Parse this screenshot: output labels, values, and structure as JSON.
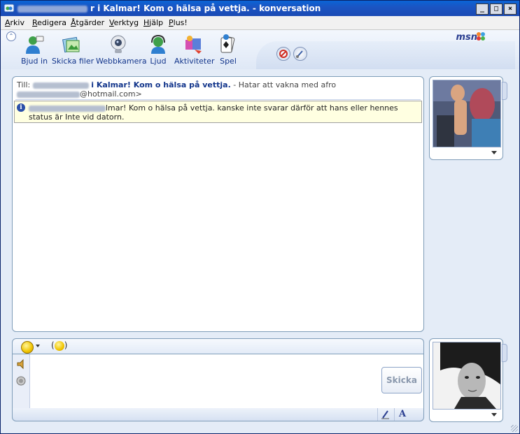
{
  "window": {
    "title": "r i Kalmar! Kom o hälsa på vettja. - konversation",
    "buttons": [
      "_",
      "□",
      "×"
    ]
  },
  "menu": [
    {
      "label": "Arkiv",
      "ul": "A",
      "rest": "rkiv"
    },
    {
      "label": "Redigera",
      "ul": "R",
      "rest": "edigera"
    },
    {
      "label": "Åtgärder",
      "ul": "Å",
      "rest": "tgärder"
    },
    {
      "label": "Verktyg",
      "ul": "V",
      "rest": "erktyg"
    },
    {
      "label": "Hjälp",
      "ul": "H",
      "rest": "jälp"
    },
    {
      "label": "Plus!",
      "ul": "P",
      "rest": "lus!"
    }
  ],
  "toolbar": {
    "invite": "Bjud in",
    "send_files": "Skicka filer",
    "webcam": "Webbkamera",
    "audio": "Ljud",
    "activities": "Aktiviteter",
    "games": "Spel",
    "brand": "msn"
  },
  "conversation": {
    "to_prefix": "Till:",
    "to_name_visible": "i Kalmar! Kom o hälsa på vettja.",
    "to_personal_message": "- Hatar att vakna med afro",
    "to_email_visible": "@hotmail.com>",
    "info_text_visible": "lmar! Kom o hälsa på vettja. kanske inte svarar därför att hans eller hennes status är Inte vid datorn."
  },
  "input": {
    "send_label": "Skicka",
    "font_button": "A"
  },
  "colors": {
    "title_bar": "#1b55c3",
    "link_blue": "#12358b",
    "info_bg": "#ffffe1",
    "panel_border": "#7f9db9"
  }
}
